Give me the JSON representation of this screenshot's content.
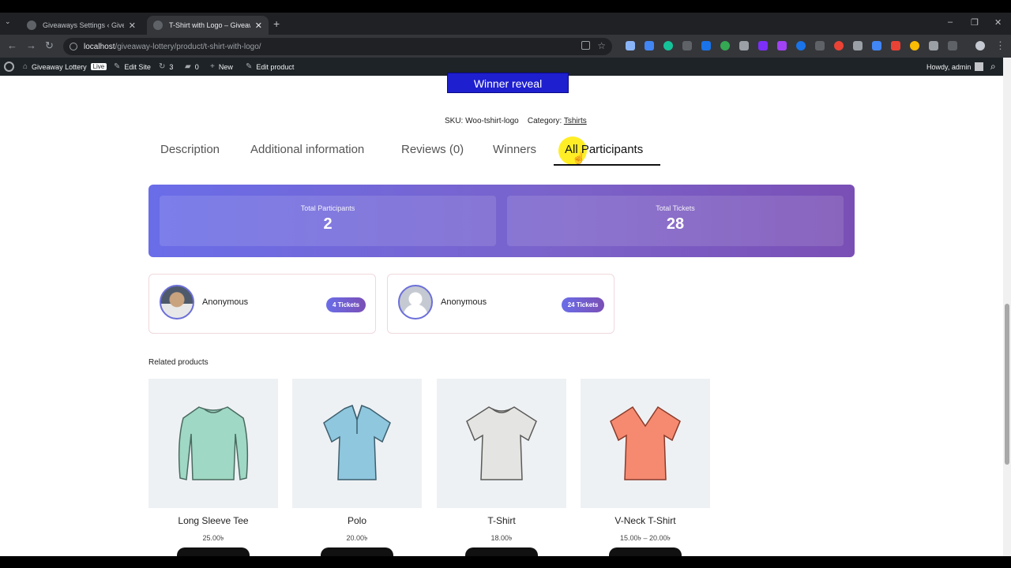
{
  "browser": {
    "tabs": [
      {
        "label": "Giveaways Settings ‹ Giveaway L"
      },
      {
        "label": "T-Shirt with Logo – Giveaway L"
      }
    ],
    "url_host": "localhost",
    "url_path": "/giveaway-lottery/product/t-shirt-with-logo/"
  },
  "wp_admin_bar": {
    "site_name": "Giveaway Lottery",
    "live_badge": "Live",
    "edit_site": "Edit Site",
    "updates_count": "3",
    "comments_count": "0",
    "new_label": "New",
    "edit_product": "Edit product",
    "howdy": "Howdy, admin"
  },
  "product": {
    "winner_reveal_label": "Winner reveal",
    "sku_label": "SKU:",
    "sku_value": "Woo-tshirt-logo",
    "category_label": "Category:",
    "category_value": "Tshirts"
  },
  "product_tabs": [
    {
      "label": "Description"
    },
    {
      "label": "Additional information"
    },
    {
      "label": "Reviews (0)"
    },
    {
      "label": "Winners"
    },
    {
      "label": "All Participants",
      "active": true
    }
  ],
  "stats": {
    "total_participants_label": "Total Participants",
    "total_participants_value": "2",
    "total_tickets_label": "Total Tickets",
    "total_tickets_value": "28"
  },
  "participants": [
    {
      "name": "Anonymous",
      "tickets": "4 Tickets",
      "avatar": "photo"
    },
    {
      "name": "Anonymous",
      "tickets": "24 Tickets",
      "avatar": "placeholder"
    }
  ],
  "related": {
    "heading": "Related products",
    "products": [
      {
        "name": "Long Sleeve Tee",
        "price": "25.00৳",
        "color": "#9fd8c4"
      },
      {
        "name": "Polo",
        "price": "20.00৳",
        "color": "#8ec7de"
      },
      {
        "name": "T-Shirt",
        "price": "18.00৳",
        "color": "#e4e4e2"
      },
      {
        "name": "V-Neck T-Shirt",
        "price": "15.00৳ – 20.00৳",
        "color": "#f58a70"
      }
    ]
  },
  "colors": {
    "accent": "#1e1fcf",
    "gradient_start": "#6a6de8",
    "gradient_end": "#7a4fb5"
  }
}
